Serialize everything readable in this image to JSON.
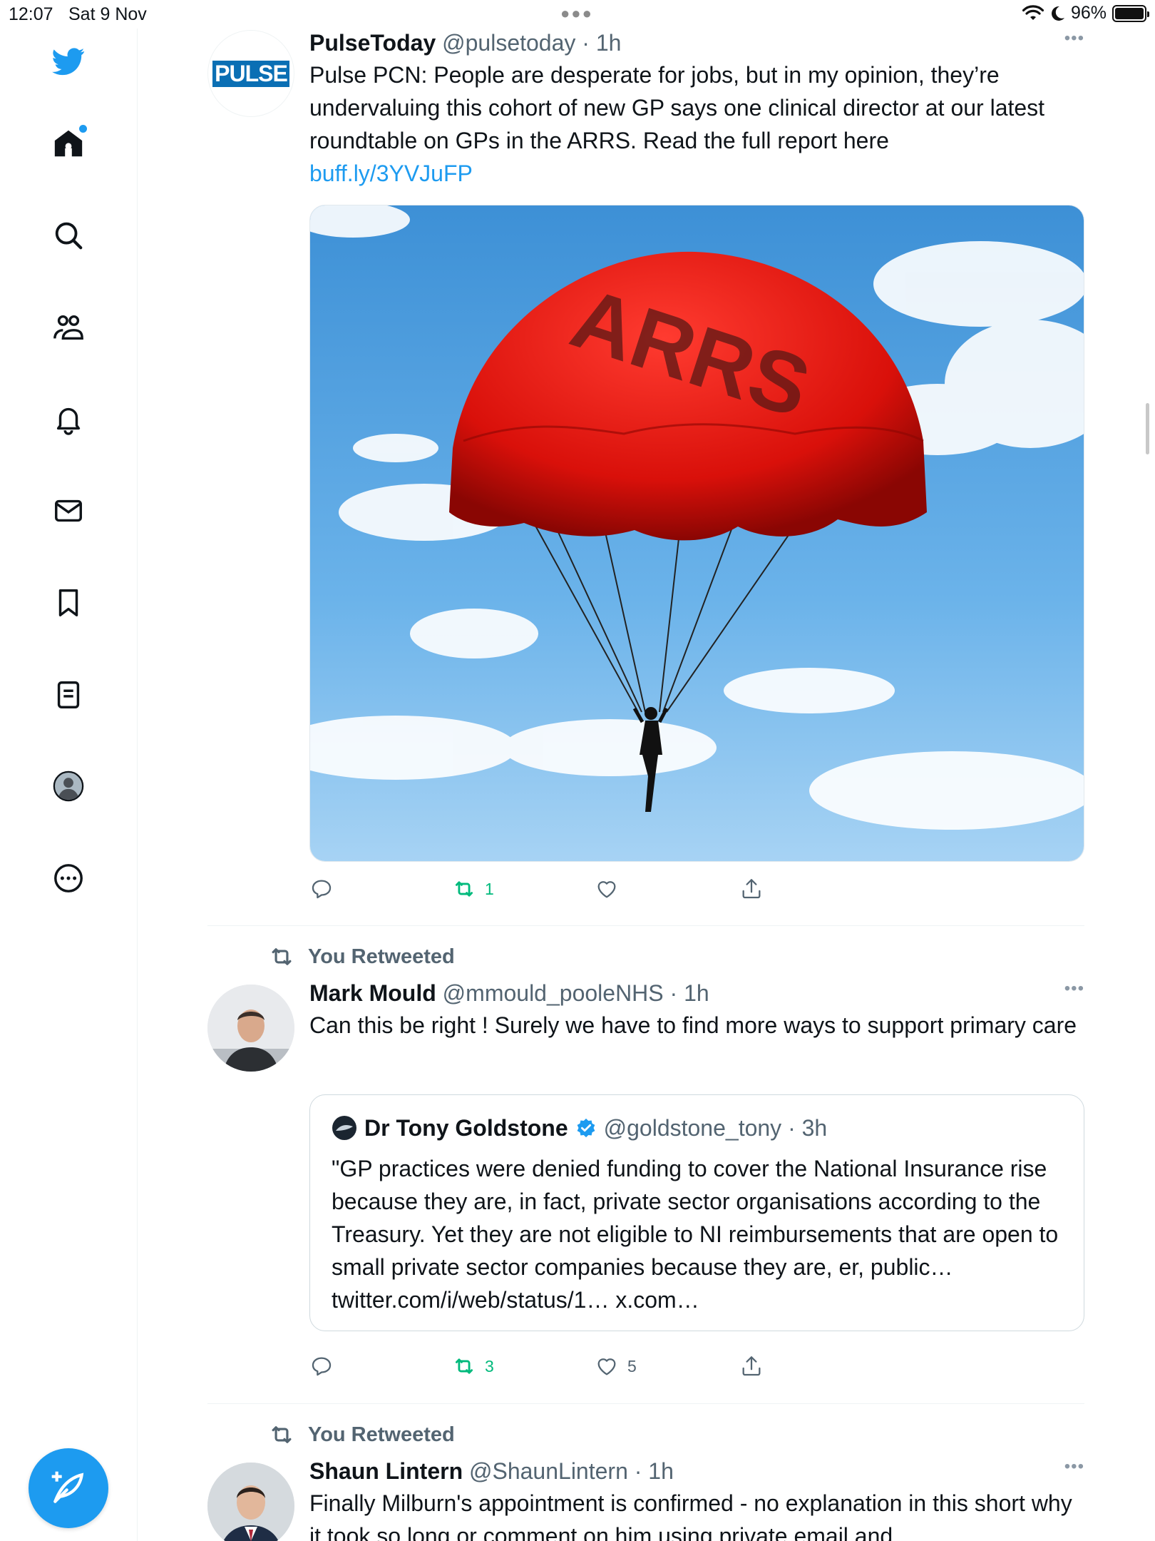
{
  "status_bar": {
    "time": "12:07",
    "date": "Sat 9 Nov",
    "battery": "96%"
  },
  "sidebar": {
    "items": [
      {
        "name": "twitter-logo"
      },
      {
        "name": "home"
      },
      {
        "name": "search"
      },
      {
        "name": "communities"
      },
      {
        "name": "notifications"
      },
      {
        "name": "messages"
      },
      {
        "name": "bookmarks"
      },
      {
        "name": "lists"
      },
      {
        "name": "profile"
      },
      {
        "name": "more"
      }
    ]
  },
  "tweets": [
    {
      "author_name": "PulseToday",
      "author_meta": "@pulsetoday · 1h",
      "avatar_text": "PULSE",
      "text": "Pulse PCN: People are desperate for jobs, but in my opinion, they’re undervaluing this cohort of new GP says one clinical director at our latest roundtable on GPs in the ARRS. Read the full report here",
      "link": "buff.ly/3YVJuFP",
      "media_label": "ARRS",
      "retweets": "1"
    },
    {
      "retweet_label": "You Retweeted",
      "author_name": "Mark Mould",
      "author_meta": "@mmould_pooleNHS · 1h",
      "text": "Can this be right ! Surely we have to find more ways to support primary care",
      "quote": {
        "author_name": "Dr Tony Goldstone",
        "author_meta": "@goldstone_tony · 3h",
        "text": "\"GP practices were denied funding to cover the National Insurance rise because they are, in fact, private sector organisations according to the Treasury. Yet they are not eligible to NI reimbursements that are open to small private sector companies because they are, er, public… twitter.com/i/web/status/1… x.com…"
      },
      "retweets": "3",
      "likes": "5"
    },
    {
      "retweet_label": "You Retweeted",
      "author_name": "Shaun Lintern",
      "author_meta": "@ShaunLintern · 1h",
      "text": "Finally Milburn's appointment is confirmed - no explanation in this short why it took so long or comment on him using private email and"
    }
  ],
  "colors": {
    "accent": "#1d9bf0",
    "retweet_green": "#00ba7c",
    "muted": "#536471"
  }
}
